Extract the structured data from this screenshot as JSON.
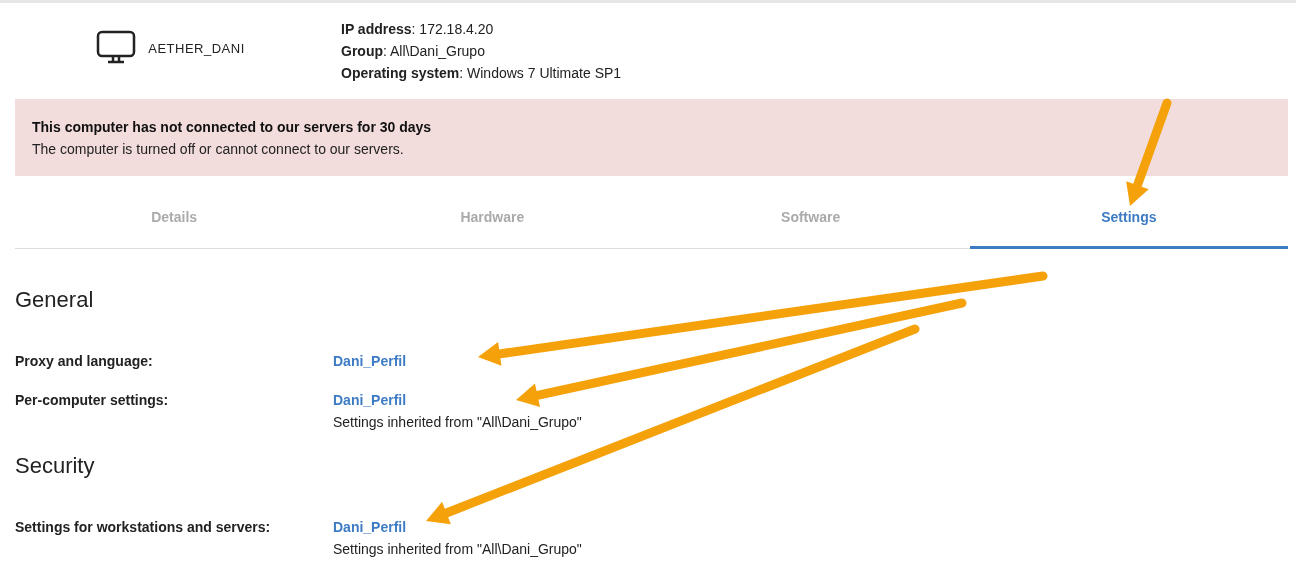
{
  "device": {
    "name": "AETHER_DANI",
    "info": [
      "**IP address**: 172.18.4.20",
      "**Group**: All\\Dani_Grupo",
      "**Operating system**: Windows 7 Ultimate SP1"
    ]
  },
  "alert": {
    "title": "This computer has not connected to our servers for 30 days",
    "message": "The computer is turned off or cannot connect to our servers."
  },
  "tabs": [
    {
      "label": "Details",
      "selected": false
    },
    {
      "label": "Hardware",
      "selected": false
    },
    {
      "label": "Software",
      "selected": false
    },
    {
      "label": "Settings",
      "selected": true
    }
  ],
  "sections": [
    {
      "title": "General",
      "rows": [
        {
          "label": "Proxy and language:",
          "value": "Dani_Perfil"
        },
        {
          "label": "Per-computer settings:",
          "value": "Dani_Perfil",
          "note": "Settings inherited from \"All\\Dani_Grupo\""
        }
      ]
    },
    {
      "title": "Security",
      "rows": [
        {
          "label": "Settings for workstations and servers:",
          "value": "Dani_Perfil",
          "note": "Settings inherited from \"All\\Dani_Grupo\""
        }
      ]
    }
  ]
}
